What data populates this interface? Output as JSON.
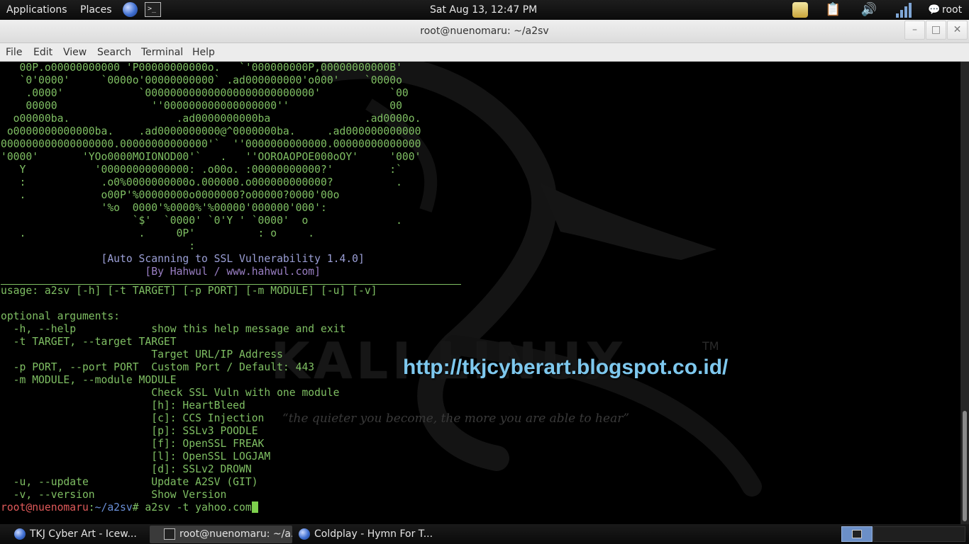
{
  "top_panel": {
    "applications": "Applications",
    "places": "Places",
    "clock": "Sat Aug 13, 12:47 PM",
    "user": "root"
  },
  "window": {
    "title": "root@nuenomaru: ~/a2sv",
    "minimize": "–",
    "maximize": "□",
    "close": "✕"
  },
  "menubar": [
    "File",
    "Edit",
    "View",
    "Search",
    "Terminal",
    "Help"
  ],
  "wallpaper": {
    "logo": "KALI LINUX",
    "tm": "TM",
    "quote": "“the quieter you become, the more you are able to hear”",
    "blog_url": "http://tkjcyberart.blogspot.co.id/"
  },
  "terminal": {
    "banner": [
      "   00P.o00000000000 'P00000000000o.   `'000000000P,00000000000B'",
      "   `0'0000'     `0000o'00000000000` .ad000000000'o000'    `0000o",
      "    .0000'            `000000000000000000000000000'           `00",
      "    00000               ''000000000000000000''                00",
      "  o00000ba.                 .ad0000000000ba               .ad0000o.",
      " o0000000000000ba.    .ad0000000000@^0000000ba.     .ad000000000000",
      "000000000000000000.00000000000000'`  ''0000000000000.00000000000000",
      "'0000'       'YOo0000MOIONOD00'`   .   ''OOROAOPOE000oOY'     '000'",
      "   Y           '00000000000000: .o00o. :00000000000?'         :`",
      "   :            .o0%0000000000o.000000.o000000000000?          .",
      "   .            o00P'%00000000o0000000?o00000?0000'00o",
      "                '%o  0000'%0000%'%00000'000000'000':",
      "                     `$'  `0000' `0'Y ' `0000'  o              .",
      "   .                  .     0P'          : o     .",
      "                              :"
    ],
    "title_line": "                [Auto Scanning to SSL Vulnerability 1.4.0]",
    "byline": "                       [By Hahwul / www.hahwul.com]",
    "help": [
      "usage: a2sv [-h] [-t TARGET] [-p PORT] [-m MODULE] [-u] [-v]",
      "",
      "optional arguments:",
      "  -h, --help            show this help message and exit",
      "  -t TARGET, --target TARGET",
      "                        Target URL/IP Address",
      "  -p PORT, --port PORT  Custom Port / Default: 443",
      "  -m MODULE, --module MODULE",
      "                        Check SSL Vuln with one module",
      "                        [h]: HeartBleed",
      "                        [c]: CCS Injection",
      "                        [p]: SSLv3 POODLE",
      "                        [f]: OpenSSL FREAK",
      "                        [l]: OpenSSL LOGJAM",
      "                        [d]: SSLv2 DROWN",
      "  -u, --update          Update A2SV (GIT)",
      "  -v, --version         Show Version"
    ],
    "prompt_user": "root@nuenomaru",
    "prompt_sep": ":",
    "prompt_path": "~/a2sv",
    "prompt_symbol": "#",
    "command": " a2sv -t yahoo.com"
  },
  "taskbar": {
    "tasks": [
      {
        "label": "TKJ Cyber Art - Icew..."
      },
      {
        "label": "root@nuenomaru: ~/a..."
      },
      {
        "label": "Coldplay - Hymn For T..."
      }
    ]
  },
  "colors": {
    "terminal_text": "#7fbf63",
    "prompt_user": "#e05a5a",
    "prompt_path": "#6a8fd6",
    "blog_url": "#7ec8ee",
    "cursor": "#7ed14d"
  }
}
